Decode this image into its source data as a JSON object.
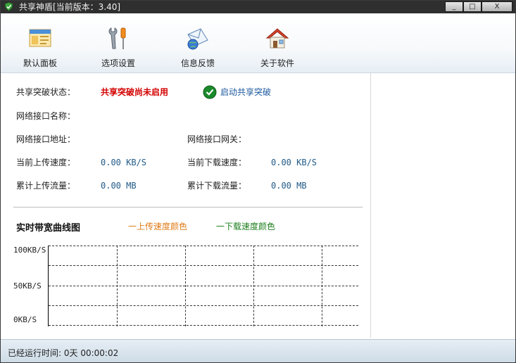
{
  "window": {
    "title": "共享神盾[当前版本：3.40]",
    "controls": {
      "minimize": "_",
      "maximize": "□",
      "close": "X"
    }
  },
  "toolbar": {
    "items": [
      {
        "label": "默认面板",
        "icon": "browser-window-icon"
      },
      {
        "label": "选项设置",
        "icon": "tools-wrench-screwdriver-icon"
      },
      {
        "label": "信息反馈",
        "icon": "mail-globe-icon"
      },
      {
        "label": "关于软件",
        "icon": "house-icon"
      }
    ]
  },
  "status": {
    "share_break_label": "共享突破状态：",
    "share_break_value": "共享突破尚未启用",
    "enable_action": "启动共享突破",
    "nic_name_label": "网络接口名称：",
    "nic_addr_label": "网络接口地址：",
    "nic_gateway_label": "网络接口网关：",
    "upload_speed_label": "当前上传速度：",
    "upload_speed_value": "0.00 KB/S",
    "download_speed_label": "当前下载速度：",
    "download_speed_value": "0.00 KB/S",
    "upload_total_label": "累计上传流量：",
    "upload_total_value": "0.00 MB",
    "download_total_label": "累计下载流量：",
    "download_total_value": "0.00 MB"
  },
  "bandwidth": {
    "title": "实时带宽曲线图",
    "upload_legend": "一上传速度颜色",
    "download_legend": "一下载速度颜色",
    "colors": {
      "upload": "#e07b17",
      "download": "#1d7f1d"
    },
    "y_labels": [
      "100KB/S",
      "50KB/S",
      "0KB/S"
    ]
  },
  "statusbar": {
    "runtime_label": "已经运行时间:",
    "runtime_value": "0天 00:00:02"
  }
}
